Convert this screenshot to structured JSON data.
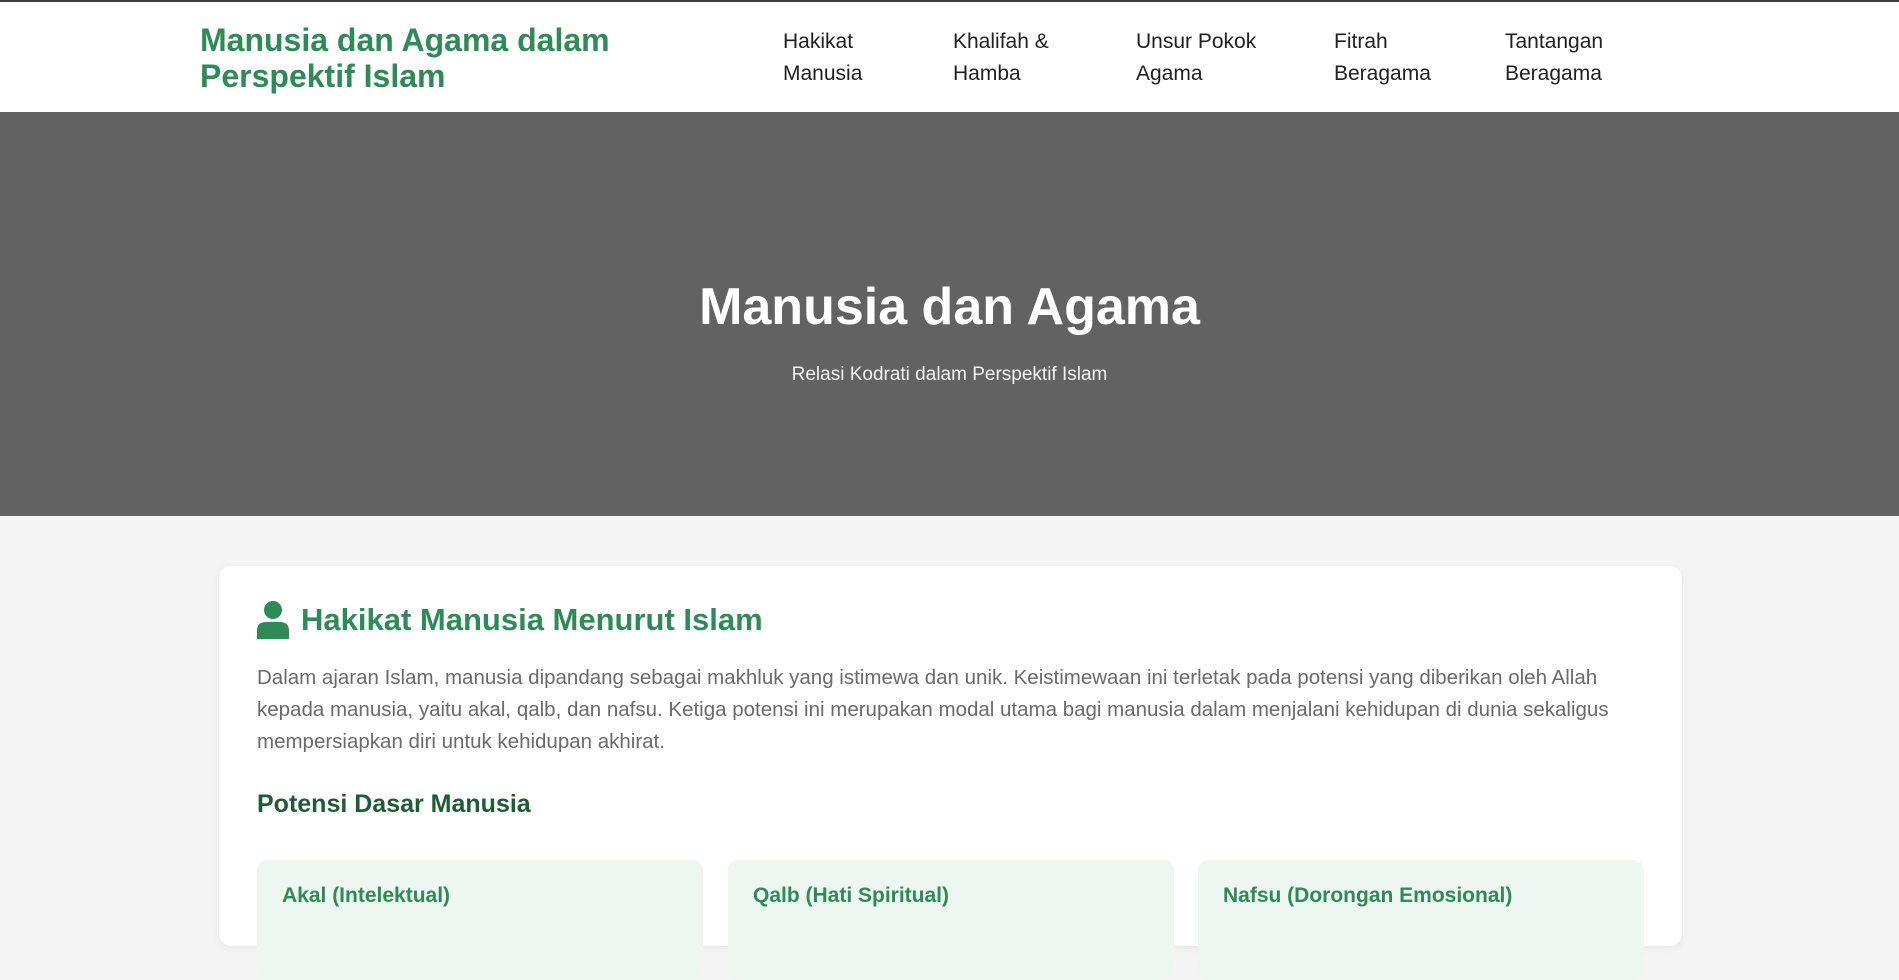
{
  "brand": {
    "line1": "Manusia dan Agama dalam",
    "line2": "Perspektif Islam",
    "color": "#2e8b57"
  },
  "nav": {
    "items": [
      {
        "line1": "Hakikat",
        "line2": "Manusia"
      },
      {
        "line1": "Khalifah &",
        "line2": "Hamba"
      },
      {
        "line1": "Unsur Pokok",
        "line2": "Agama"
      },
      {
        "line1": "Fitrah",
        "line2": "Beragama"
      },
      {
        "line1": "Tantangan",
        "line2": "Beragama"
      }
    ]
  },
  "hero": {
    "title": "Manusia dan Agama",
    "subtitle": "Relasi Kodrati dalam Perspektif Islam",
    "background": "#626262"
  },
  "section": {
    "icon": "user-icon",
    "title": "Hakikat Manusia Menurut Islam",
    "intro": "Dalam ajaran Islam, manusia dipandang sebagai makhluk yang istimewa dan unik. Keistimewaan ini terletak pada potensi yang diberikan oleh Allah kepada manusia, yaitu akal, qalb, dan nafsu. Ketiga potensi ini merupakan modal utama bagi manusia dalam menjalani kehidupan di dunia sekaligus mempersiapkan diri untuk kehidupan akhirat.",
    "subheading": "Potensi Dasar Manusia",
    "potensi": [
      {
        "title": "Akal (Intelektual)"
      },
      {
        "title": "Qalb (Hati Spiritual)"
      },
      {
        "title": "Nafsu (Dorongan Emosional)"
      }
    ]
  }
}
